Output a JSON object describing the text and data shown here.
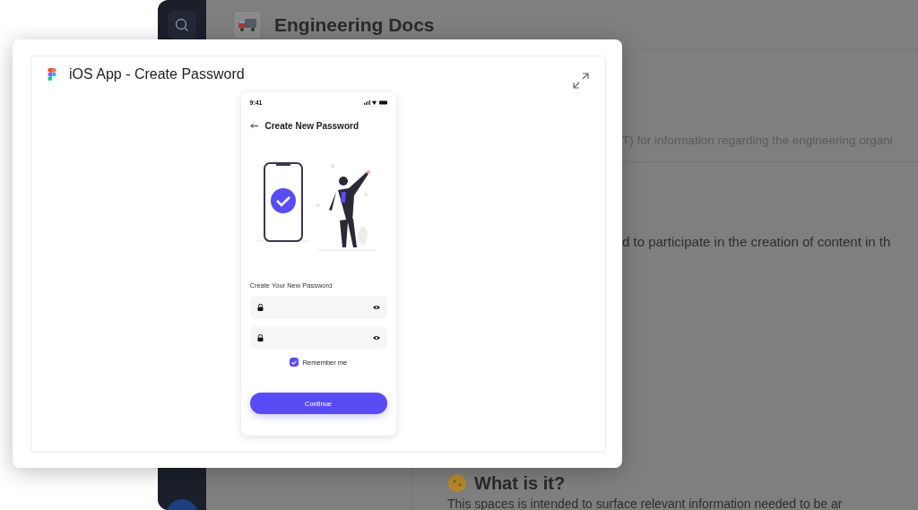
{
  "background": {
    "page_title": "Engineering Docs",
    "lines": [
      {
        "text": "T) for information regarding the engineering organi",
        "kind": "muted"
      },
      {
        "text": "d to participate in the creation of content in th",
        "kind": "body"
      }
    ],
    "section_heading": "What is it?",
    "section_text": "This spaces is intended to surface relevant information needed to be ar"
  },
  "dialog": {
    "title": "iOS App - Create Password",
    "phone": {
      "time": "9:41",
      "screen_title": "Create New Password",
      "prompt": "Create Your New Password",
      "remember": {
        "label": "Remember me",
        "checked": true
      },
      "button": "Continue"
    }
  }
}
